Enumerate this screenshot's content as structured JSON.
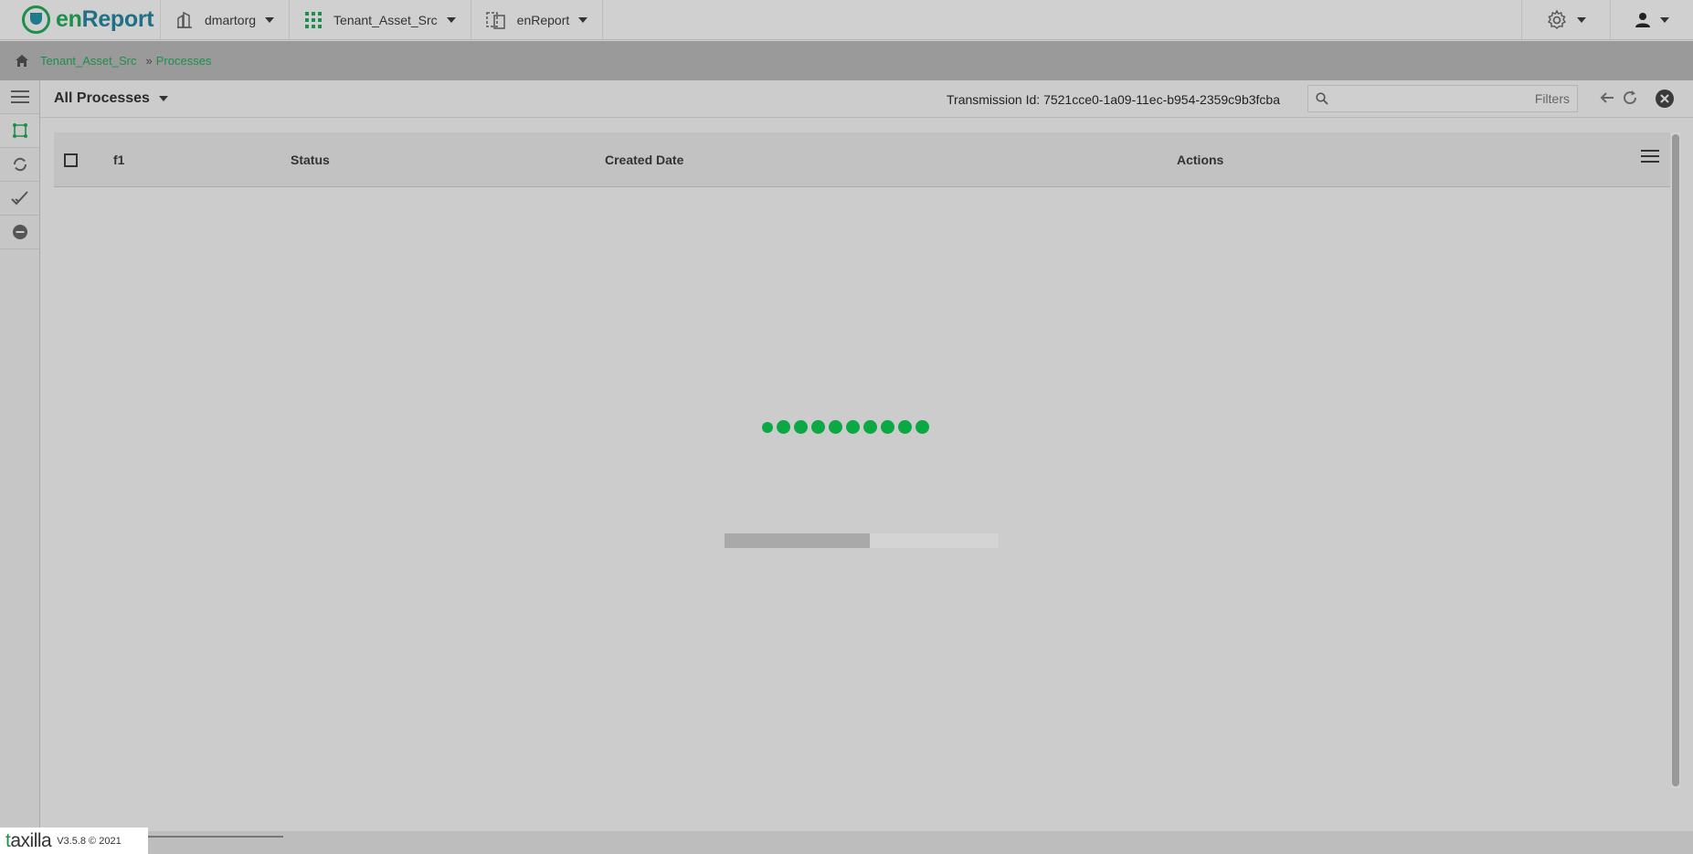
{
  "app": {
    "brand_prefix": "en",
    "brand_suffix": "Report"
  },
  "topbar": {
    "org": "dmartorg",
    "tenant": "Tenant_Asset_Src",
    "app_switch": "enReport"
  },
  "breadcrumb": {
    "items": [
      "Tenant_Asset_Src",
      "Processes"
    ],
    "separator": "»"
  },
  "toolbar": {
    "view": "All Processes",
    "transmission": "Transmission Id: 7521cce0-1a09-11ec-b954-2359c9b3fcba",
    "search_placeholder": "",
    "filters_label": "Filters"
  },
  "table": {
    "columns": [
      "f1",
      "Status",
      "Created Date",
      "Actions"
    ]
  },
  "loader": {
    "dot_count": 10,
    "progress": 0.53
  },
  "footer": {
    "logo_t": "t",
    "logo_rest": "axilla",
    "version": "V3.5.8 © 2021"
  },
  "colors": {
    "accent": "#1c8f4a",
    "loader": "#0aa944"
  },
  "icons": [
    "building-icon",
    "apps-grid-icon",
    "switch-app-icon",
    "gear-icon",
    "user-icon",
    "home-icon",
    "hamburger-icon",
    "process-icon",
    "refresh-cycle-icon",
    "check-all-icon",
    "minus-circle-icon",
    "search-icon",
    "back-arrow-icon",
    "refresh-icon",
    "close-circle-icon",
    "column-menu-icon"
  ]
}
